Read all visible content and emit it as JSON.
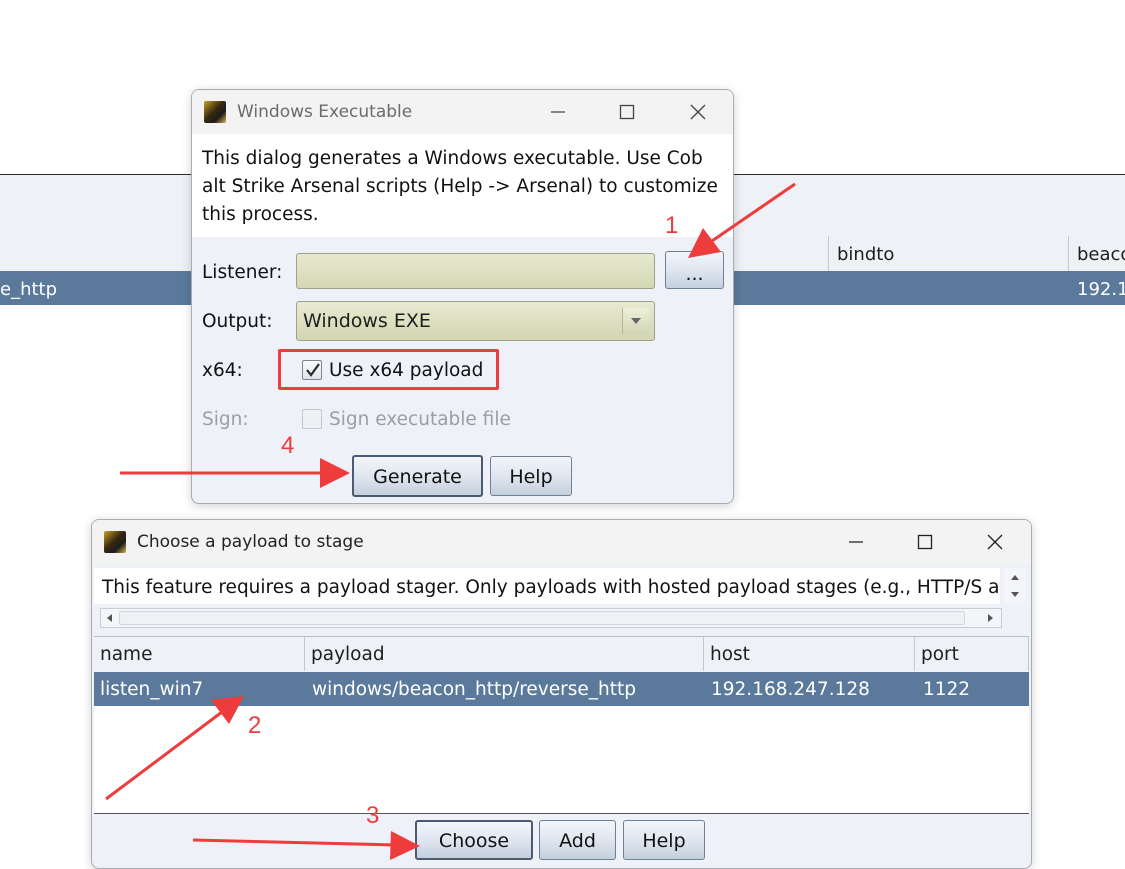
{
  "background": {
    "columns": [
      "bindto",
      "beaco"
    ],
    "row": {
      "name_fragment": "e_http",
      "beacon_fragment": "192.1"
    }
  },
  "exe_dialog": {
    "title": "Windows Executable",
    "description": "This dialog generates a Windows executable. Use Cob alt Strike Arsenal scripts (Help -> Arsenal) to customize this process.",
    "listener_label": "Listener:",
    "listener_value": "",
    "browse_label": "...",
    "output_label": "Output:",
    "output_value": "Windows EXE",
    "x64_label": "x64:",
    "x64_checkbox_label": "Use x64 payload",
    "x64_checked": true,
    "sign_label": "Sign:",
    "sign_checkbox_label": "Sign executable file",
    "sign_checked": false,
    "generate_label": "Generate",
    "help_label": "Help"
  },
  "stage_dialog": {
    "title": "Choose a payload to stage",
    "description": "This feature requires a payload stager. Only payloads with hosted payload stages (e.g., HTTP/S a",
    "columns": [
      "name",
      "payload",
      "host",
      "port"
    ],
    "rows": [
      {
        "name": "listen_win7",
        "payload": "windows/beacon_http/reverse_http",
        "host": "192.168.247.128",
        "port": "1122"
      }
    ],
    "choose_label": "Choose",
    "add_label": "Add",
    "help_label": "Help"
  },
  "annotations": {
    "step1": "1",
    "step2": "2",
    "step3": "3",
    "step4": "4",
    "color": "#ee3b3b"
  }
}
